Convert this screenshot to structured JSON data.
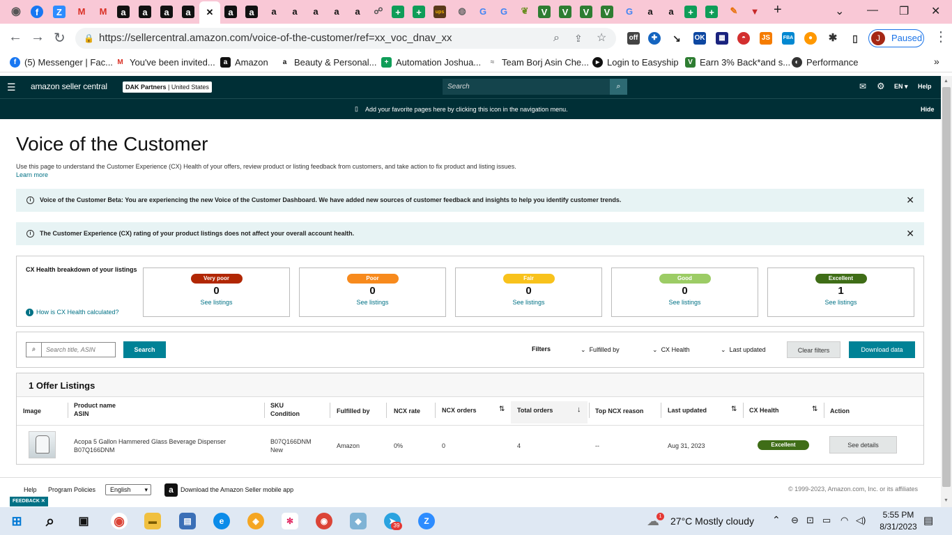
{
  "browser": {
    "url": "https://sellercentral.amazon.com/voice-of-the-customer/ref=xx_voc_dnav_xx",
    "profile_initial": "J",
    "profile_status": "Paused",
    "new_tab": "+"
  },
  "bookmarks": [
    {
      "label": "(5) Messenger | Fac...",
      "icon": "facebook-icon"
    },
    {
      "label": "You've been invited...",
      "icon": "gmail-icon"
    },
    {
      "label": "Amazon",
      "icon": "amazon-icon"
    },
    {
      "label": "Beauty & Personal...",
      "icon": "amazon-smile-icon"
    },
    {
      "label": "Automation Joshua...",
      "icon": "sheets-icon"
    },
    {
      "label": "Team Borj Asin Che...",
      "icon": "team-icon"
    },
    {
      "label": "Login to Easyship",
      "icon": "easyship-icon"
    },
    {
      "label": "Earn 3% Back*and s...",
      "icon": "vine-icon"
    },
    {
      "label": "Performance",
      "icon": "performance-icon"
    }
  ],
  "header": {
    "logo": "amazon seller central",
    "account": "DAK Partners",
    "marketplace": "United States",
    "search_placeholder": "Search",
    "language": "EN",
    "help": "Help",
    "favorites_hint": "Add your favorite pages here by clicking this icon in the navigation menu.",
    "hide": "Hide"
  },
  "page": {
    "title": "Voice of the Customer",
    "description": "Use this page to understand the Customer Experience (CX) Health of your offers, review product or listing feedback from customers, and take action to fix product and listing issues.",
    "learn_more": "Learn more",
    "banner1": "Voice of the Customer Beta: You are experiencing the new Voice of the Customer Dashboard. We have added new sources of customer feedback and insights to help you identify customer trends.",
    "banner2": "The Customer Experience (CX) rating of your product listings does not affect your overall account health."
  },
  "health": {
    "title": "CX Health breakdown of your listings",
    "how_link": "How is CX Health calculated?",
    "see_listings": "See listings",
    "boxes": [
      {
        "label": "Very poor",
        "count": "0",
        "color": "#b12704",
        "text": "#ffffff"
      },
      {
        "label": "Poor",
        "count": "0",
        "color": "#f78a1d",
        "text": "#ffffff"
      },
      {
        "label": "Fair",
        "count": "0",
        "color": "#f8c21c",
        "text": "#ffffff"
      },
      {
        "label": "Good",
        "count": "0",
        "color": "#9ccc65",
        "text": "#ffffff"
      },
      {
        "label": "Excellent",
        "count": "1",
        "color": "#3f6d17",
        "text": "#ffffff"
      }
    ]
  },
  "filters": {
    "search_placeholder": "Search title, ASIN",
    "search_button": "Search",
    "label": "Filters",
    "fulfilled_by": "Fulfilled by",
    "cx_health": "CX Health",
    "last_updated": "Last updated",
    "clear": "Clear filters",
    "download": "Download data"
  },
  "table": {
    "title": "1 Offer Listings",
    "headers": {
      "image": "Image",
      "product_name": "Product name",
      "asin": "ASIN",
      "sku": "SKU",
      "condition": "Condition",
      "fulfilled_by": "Fulfilled by",
      "ncx_rate": "NCX rate",
      "ncx_orders": "NCX orders",
      "total_orders": "Total orders",
      "top_ncx_reason": "Top NCX reason",
      "last_updated": "Last updated",
      "cx_health": "CX Health",
      "action": "Action"
    },
    "rows": [
      {
        "product_name": "Acopa 5 Gallon Hammered Glass Beverage Dispenser",
        "asin": "B07Q166DNM",
        "sku": "B07Q166DNM",
        "condition": "New",
        "fulfilled_by": "Amazon",
        "ncx_rate": "0%",
        "ncx_orders": "0",
        "total_orders": "4",
        "top_ncx_reason": "--",
        "last_updated": "Aug 31, 2023",
        "cx_health": "Excellent",
        "action": "See details"
      }
    ]
  },
  "footer": {
    "help": "Help",
    "policies": "Program Policies",
    "language": "English",
    "app": "Download the Amazon Seller mobile app",
    "copyright": "© 1999-2023, Amazon.com, Inc. or its affiliates",
    "feedback": "FEEDBACK"
  },
  "taskbar": {
    "weather": "27°C  Mostly cloudy",
    "time": "5:55 PM",
    "date": "8/31/2023",
    "weather_badge": "1",
    "telegram_badge": "39"
  },
  "colors": {
    "accent_teal": "#007185",
    "header_bg": "#002f36",
    "banner_bg": "#e7f3f4",
    "button_teal": "#008296"
  }
}
